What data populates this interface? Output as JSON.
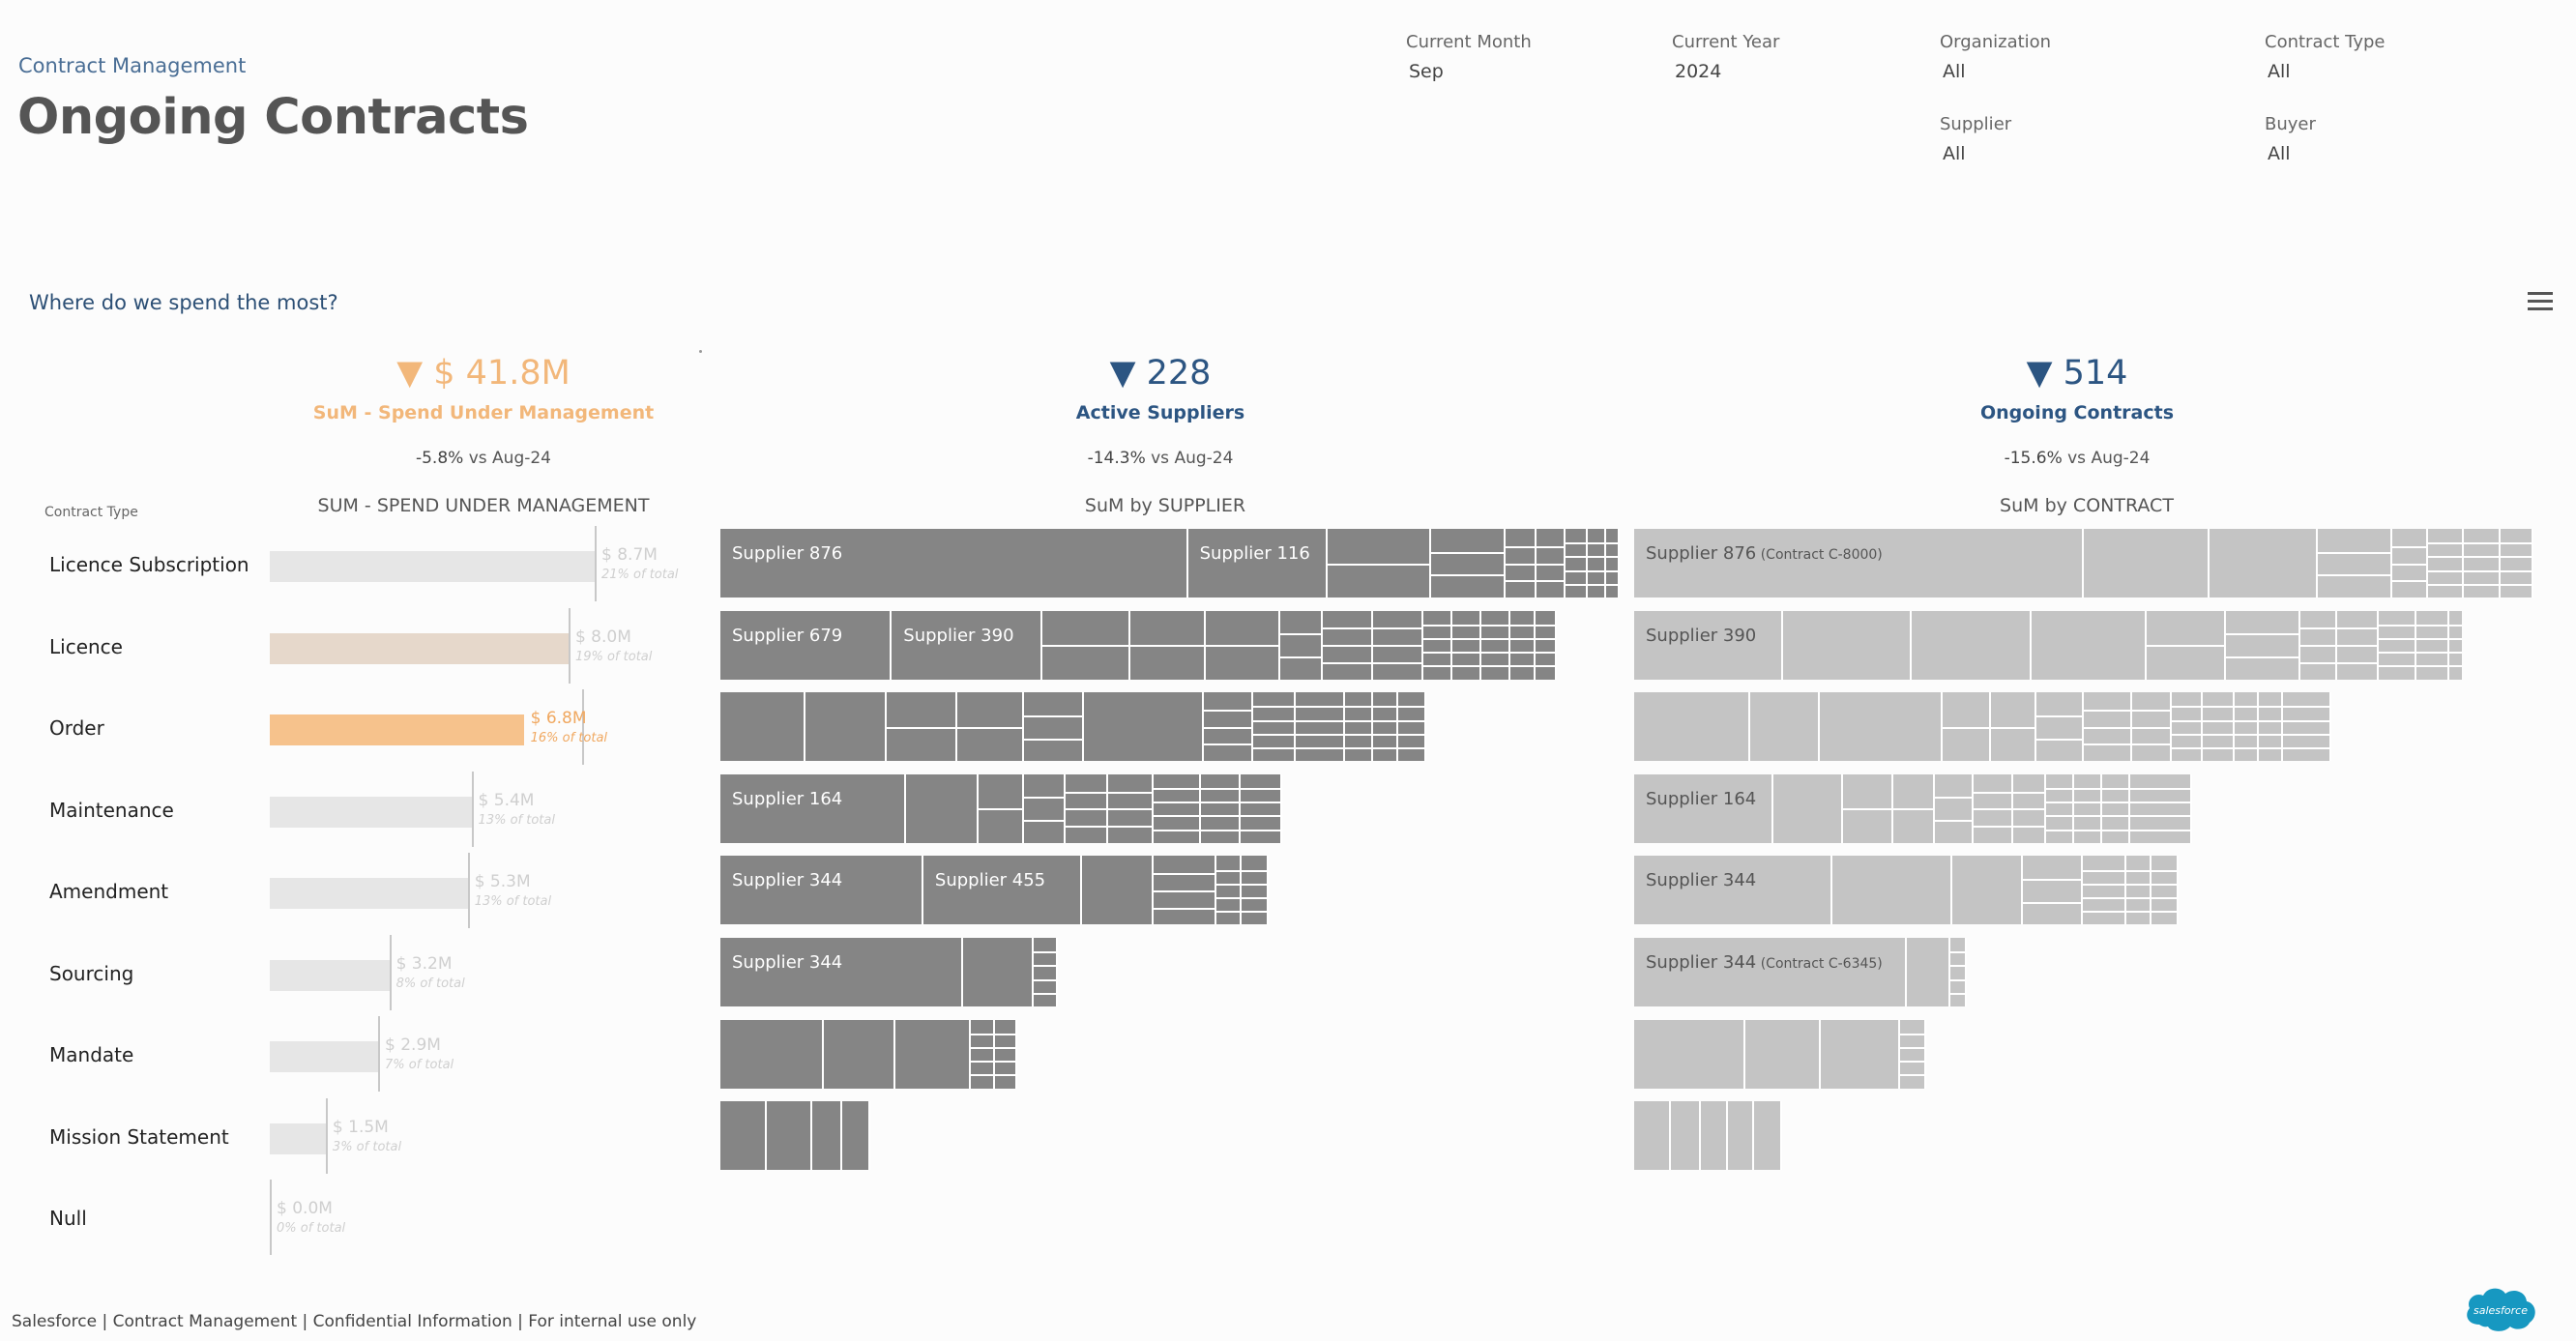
{
  "header": {
    "breadcrumb": "Contract Management",
    "title": "Ongoing Contracts"
  },
  "filters": [
    {
      "label": "Current Month",
      "value": "Sep"
    },
    {
      "label": "Current Year",
      "value": "2024"
    },
    {
      "label": "Organization",
      "value": "All"
    },
    {
      "label": "Contract Type",
      "value": "All"
    },
    {
      "label": "Supplier",
      "value": "All"
    },
    {
      "label": "Buyer",
      "value": "All"
    }
  ],
  "section": {
    "question": "Where do we spend the most?",
    "menu_icon": "hamburger-icon"
  },
  "kpis": [
    {
      "arrow": "▼",
      "value": "$ 41.8M",
      "label": "SuM - Spend Under Management",
      "delta": "-5.8%",
      "delta_suffix": " vs Aug-24",
      "color": "#f2b77a"
    },
    {
      "arrow": "▼",
      "value": "228",
      "label": "Active Suppliers",
      "delta": "-14.3%",
      "delta_suffix": " vs Aug-24",
      "color": "#2c5582"
    },
    {
      "arrow": "▼",
      "value": "514",
      "label": "Ongoing Contracts",
      "delta": "-15.6%",
      "delta_suffix": " vs Aug-24",
      "color": "#2c5582"
    }
  ],
  "colors": {
    "bar_default": "#e6e6e6",
    "bar_highlight": "#f6c28c",
    "bar_light": "#e6d8cb",
    "treemap_supplier": "#858585",
    "treemap_contract": "#c4c4c4",
    "value_default": "#cfcfcf",
    "value_highlight": "#f0a860"
  },
  "chart_data": [
    {
      "type": "bar",
      "title": "SUM - SPEND UNDER MANAGEMENT",
      "column_header": "Contract Type",
      "categories": [
        "Licence Subscription",
        "Licence",
        "Order",
        "Maintenance",
        "Amendment",
        "Sourcing",
        "Mandate",
        "Mission Statement",
        "Null"
      ],
      "values": [
        8.7,
        8.0,
        6.8,
        5.4,
        5.3,
        3.2,
        2.9,
        1.5,
        0.0
      ],
      "value_labels": [
        "$ 8.7M",
        "$ 8.0M",
        "$ 6.8M",
        "$ 5.4M",
        "$ 5.3M",
        "$ 3.2M",
        "$ 2.9M",
        "$ 1.5M",
        "$ 0.0M"
      ],
      "pct_labels": [
        "21% of total",
        "19% of total",
        "16% of total",
        "13% of total",
        "13% of total",
        "8% of total",
        "7% of total",
        "3% of total",
        "0% of total"
      ],
      "highlight": [
        false,
        "light",
        true,
        false,
        false,
        false,
        false,
        false,
        false
      ]
    },
    {
      "type": "treemap",
      "title": "SuM by SUPPLIER",
      "rows": [
        {
          "total": 100,
          "labels": [
            "Supplier 876",
            "Supplier 116"
          ]
        },
        {
          "total": 93,
          "labels": [
            "Supplier 679",
            "Supplier 390"
          ]
        },
        {
          "total": 78.5,
          "labels": []
        },
        {
          "total": 62.5,
          "labels": [
            "Supplier 164"
          ]
        },
        {
          "total": 61,
          "labels": [
            "Supplier 344",
            "Supplier 455"
          ]
        },
        {
          "total": 37.5,
          "labels": [
            "Supplier 344"
          ]
        },
        {
          "total": 33,
          "labels": []
        },
        {
          "total": 16.7,
          "labels": []
        }
      ]
    },
    {
      "type": "treemap",
      "title": "SuM by CONTRACT",
      "rows": [
        {
          "total": 100,
          "labels": [
            "Supplier 876"
          ],
          "sublabel": "(Contract C-8000)"
        },
        {
          "total": 92,
          "labels": [
            "Supplier 390"
          ]
        },
        {
          "total": 77.5,
          "labels": []
        },
        {
          "total": 62,
          "labels": [
            "Supplier 164"
          ]
        },
        {
          "total": 60.5,
          "labels": [
            "Supplier 344"
          ]
        },
        {
          "total": 37,
          "labels": [
            "Supplier 344"
          ],
          "sublabel": "(Contract C-6345)"
        },
        {
          "total": 32.5,
          "labels": []
        },
        {
          "total": 16.5,
          "labels": []
        }
      ]
    }
  ],
  "footer": {
    "text": "Salesforce | Contract Management | Confidential Information | For internal use only",
    "logo_text": "salesforce"
  }
}
